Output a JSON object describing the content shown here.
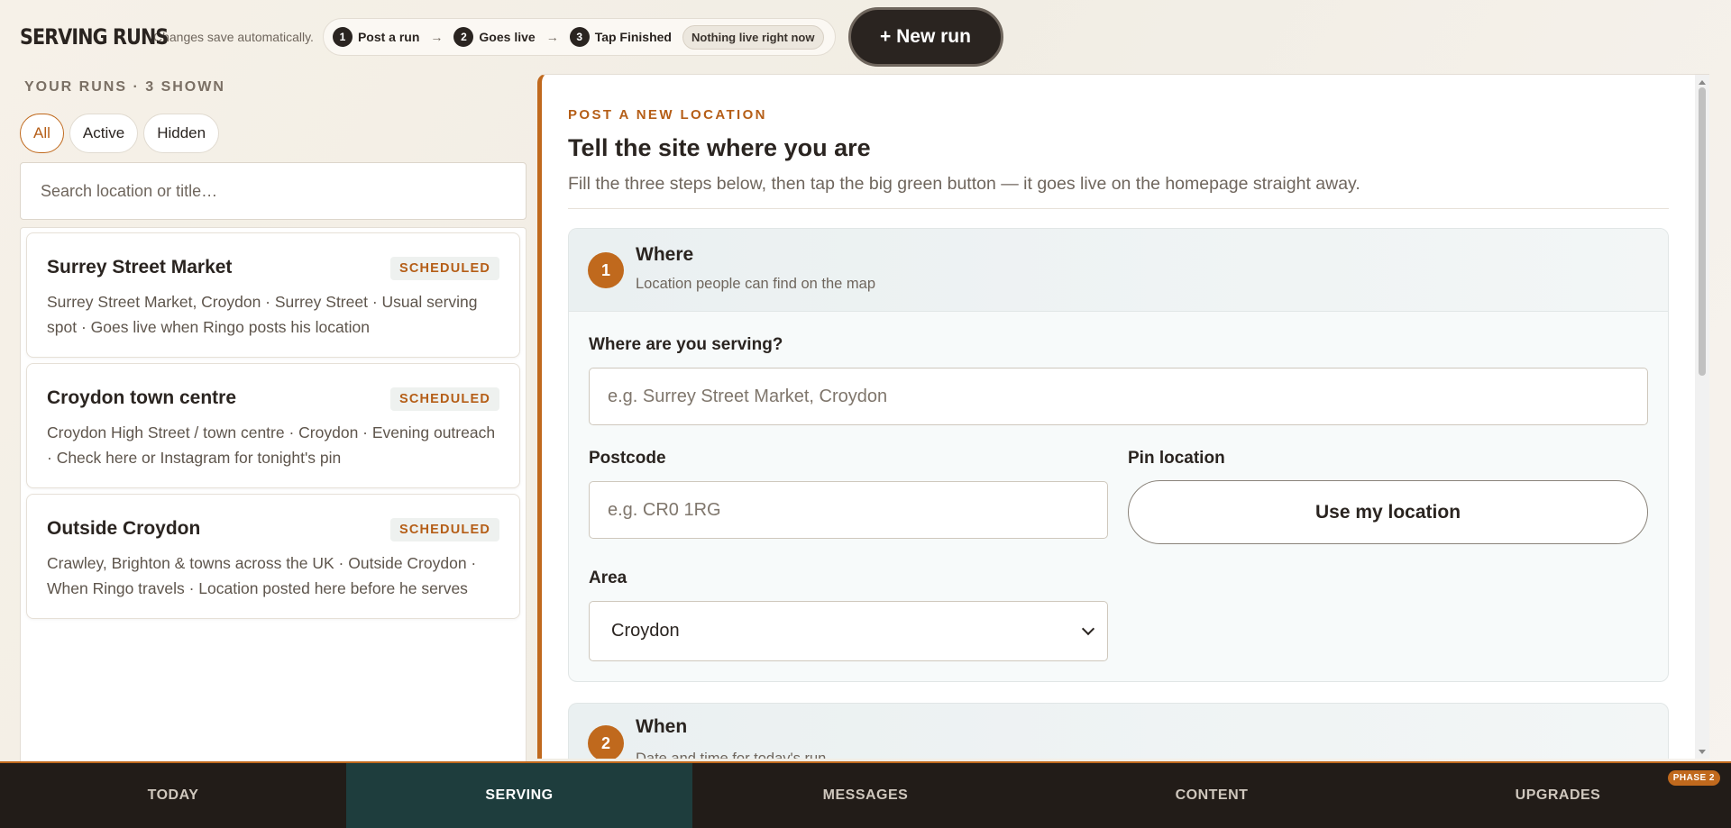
{
  "header": {
    "brand": "SERVING RUNS",
    "autosave": "Changes save automatically.",
    "steps": [
      {
        "num": "1",
        "label": "Post a run"
      },
      {
        "num": "2",
        "label": "Goes live"
      },
      {
        "num": "3",
        "label": "Tap Finished"
      }
    ],
    "arrow": "→",
    "live_status": "Nothing live right now",
    "new_run_label": "+ New run"
  },
  "left": {
    "heading": "YOUR RUNS · 3 SHOWN",
    "filters": [
      "All",
      "Active",
      "Hidden"
    ],
    "active_filter": "All",
    "search_placeholder": "Search location or title…",
    "runs": [
      {
        "title": "Surrey Street Market",
        "status": "SCHEDULED",
        "description": "Surrey Street Market, Croydon · Surrey Street · Usual serving spot · Goes live when Ringo posts his location"
      },
      {
        "title": "Croydon town centre",
        "status": "SCHEDULED",
        "description": "Croydon High Street / town centre · Croydon · Evening outreach · Check here or Instagram for tonight's pin"
      },
      {
        "title": "Outside Croydon",
        "status": "SCHEDULED",
        "description": "Crawley, Brighton & towns across the UK · Outside Croydon · When Ringo travels · Location posted here before he serves"
      }
    ]
  },
  "form": {
    "eyebrow": "POST A NEW LOCATION",
    "title": "Tell the site where you are",
    "subtitle": "Fill the three steps below, then tap the big green button — it goes live on the homepage straight away.",
    "step1": {
      "num": "1",
      "title": "Where",
      "subtitle": "Location people can find on the map",
      "where_label": "Where are you serving?",
      "where_placeholder": "e.g. Surrey Street Market, Croydon",
      "postcode_label": "Postcode",
      "postcode_placeholder": "e.g. CR0 1RG",
      "pin_label": "Pin location",
      "pin_button": "Use my location",
      "area_label": "Area",
      "area_value": "Croydon"
    },
    "step2": {
      "num": "2",
      "title": "When",
      "subtitle": "Date and time for today's run"
    }
  },
  "bottom_nav": {
    "tabs": [
      "TODAY",
      "SERVING",
      "MESSAGES",
      "CONTENT",
      "UPGRADES"
    ],
    "active": "SERVING",
    "badge": "PHASE 2"
  },
  "colors": {
    "accent": "#c0691d",
    "dark": "#2a2420",
    "active_nav": "#1e3d3d"
  }
}
